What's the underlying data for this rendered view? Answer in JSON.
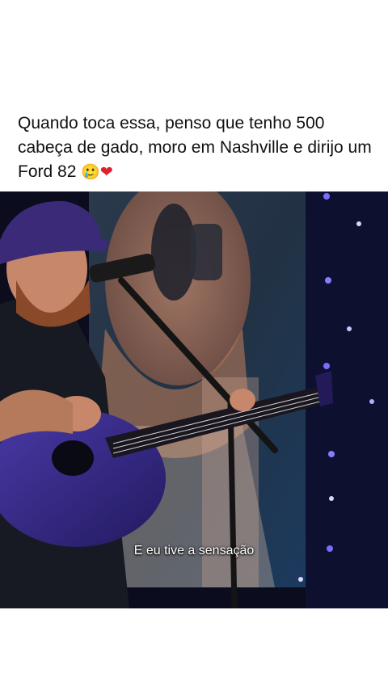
{
  "post": {
    "caption_text": "Quando toca essa, penso que tenho 500 cabeça de gado, moro em Nashville e dirijo um Ford 82 ",
    "emoji_1": "🥲",
    "emoji_2": "❤"
  },
  "video": {
    "subtitle": "E eu tive a sensação"
  },
  "colors": {
    "background": "#ffffff",
    "text": "#111111",
    "video_bg": "#0b0d1f",
    "guitar": "#3a2a8a",
    "heart": "#e0202a"
  }
}
